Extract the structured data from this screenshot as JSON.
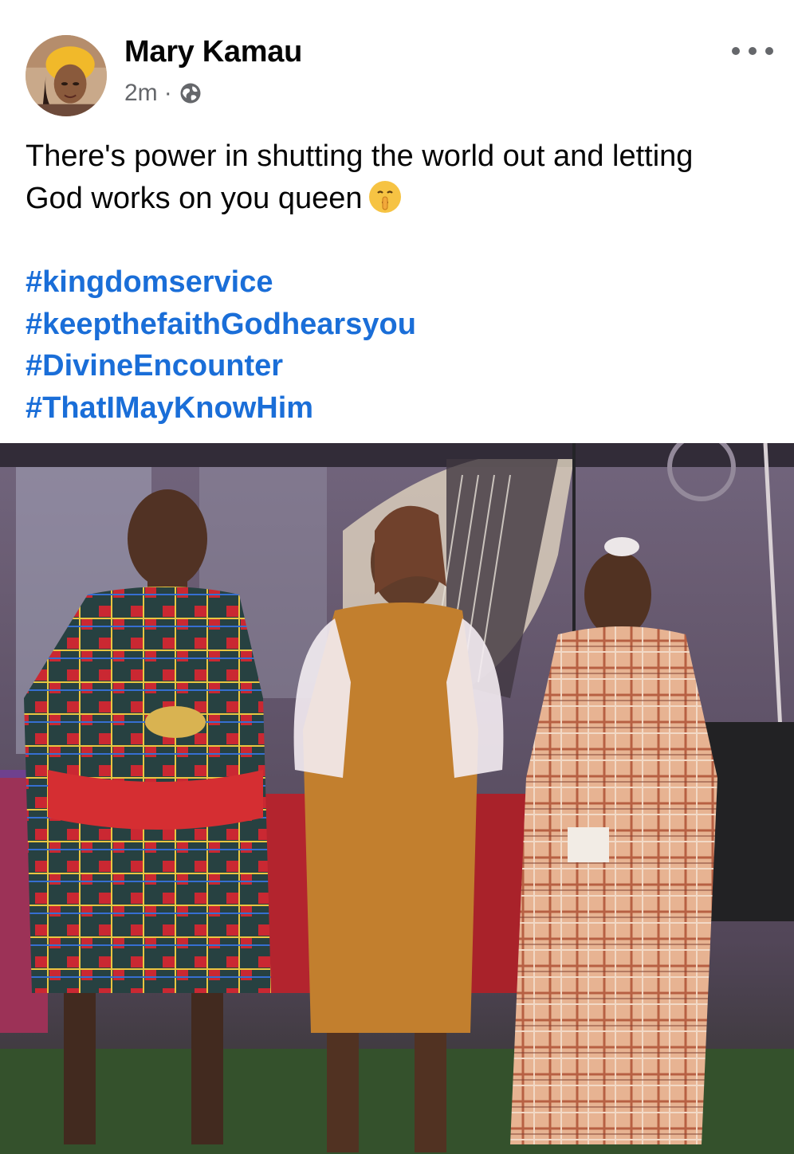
{
  "post": {
    "author": "Mary Kamau",
    "time": "2m",
    "separator": "·",
    "privacy_icon": "globe-icon",
    "more_icon": "more-horizontal-icon",
    "text_line1": "There's power in shutting the world out and letting",
    "text_line2": "God works on you queen",
    "emoji": "shushing-face-emoji",
    "hashtags": [
      "#kingdomservice",
      "#keepthefaithGodhearsyou",
      "#DivineEncounter",
      "#ThatIMayKnowHim"
    ]
  },
  "colors": {
    "hashtag": "#1a6ed8",
    "secondary_text": "#65676b",
    "primary_text": "#050505"
  }
}
